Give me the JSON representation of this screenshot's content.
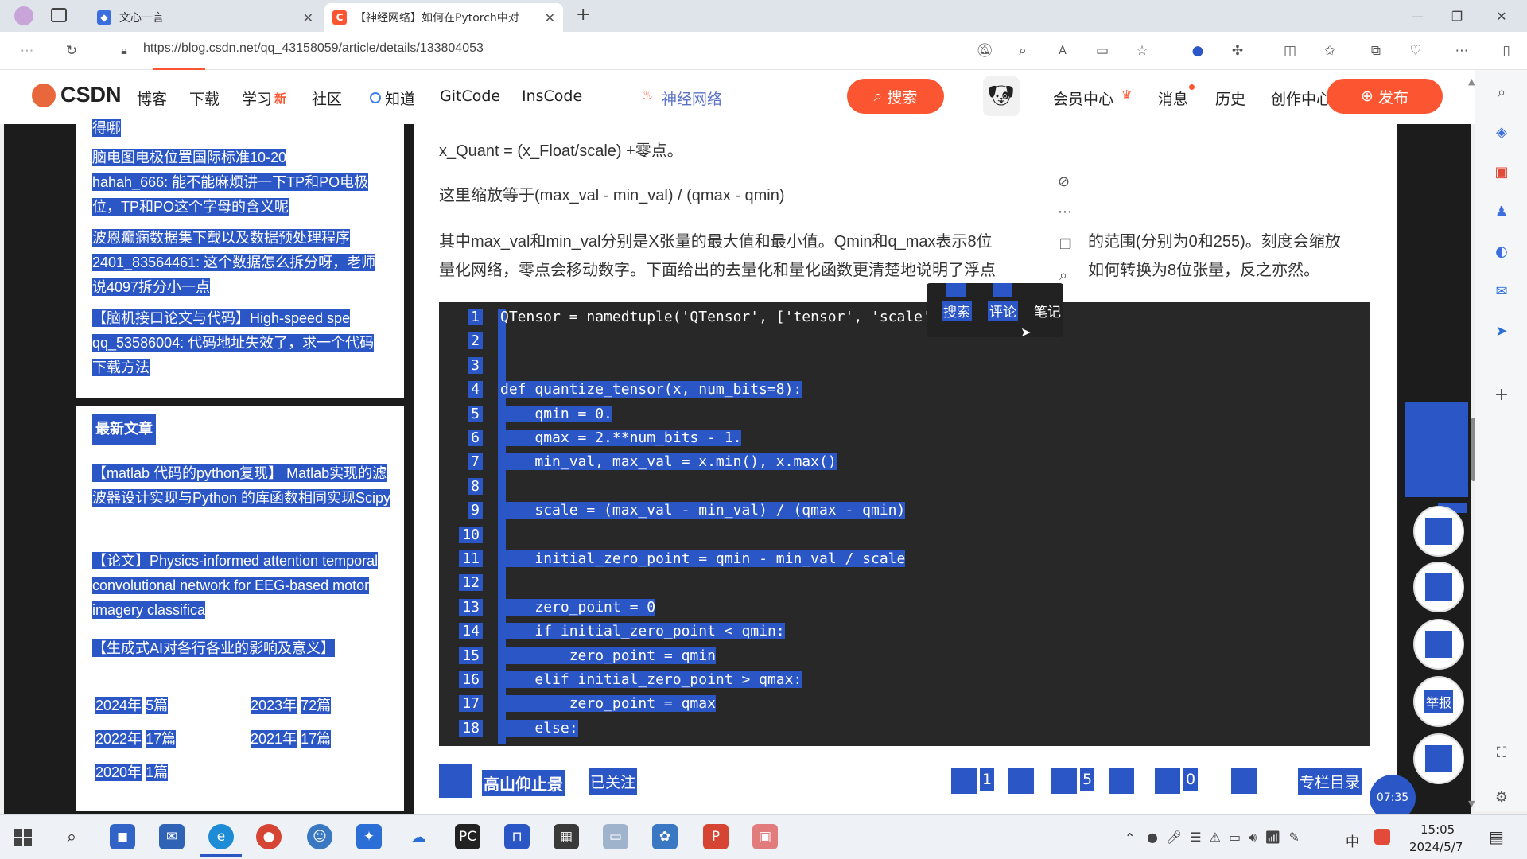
{
  "browser": {
    "tabs": [
      {
        "title": "文心一言",
        "active": false
      },
      {
        "title": "【神经网络】如何在Pytorch中对",
        "active": true
      }
    ],
    "new_tab": "+",
    "url": "https://blog.csdn.net/qq_43158059/article/details/133804053"
  },
  "csdn": {
    "logo": "CSDN",
    "nav": [
      "博客",
      "下载",
      "学习",
      "社区",
      "知道",
      "GitCode",
      "InsCode"
    ],
    "learn_badge": "新",
    "hot_search": "神经网络",
    "search_button": "搜索",
    "user_nav": [
      "会员中心",
      "消息",
      "历史",
      "创作中心"
    ],
    "publish_button": "发布"
  },
  "sidebar": {
    "cut_top": "得哪",
    "comments": [
      {
        "title": "脑电图电极位置国际标准10-20",
        "comment": "hahah_666: 能不能麻烦讲一下TP和PO电极位，TP和PO这个字母的含义呢"
      },
      {
        "title": "波恩癫痫数据集下载以及数据预处理程序",
        "comment": "2401_83564461: 这个数据怎么拆分呀，老师说4097拆分小一点"
      },
      {
        "title": "【脑机接口论文与代码】High-speed spe",
        "comment": "qq_53586004: 代码地址失效了，求一个代码下载方法"
      }
    ],
    "latest_header": "最新文章",
    "latest_articles": [
      "【matlab 代码的python复现】 Matlab实现的滤波器设计实现与Python 的库函数相同实现Scipy",
      "【论文】Physics-informed attention temporal convolutional network for EEG-based motor imagery classifica",
      "【生成式AI对各行各业的影响及意义】"
    ],
    "archive": [
      {
        "year": "2024年",
        "count": "5篇"
      },
      {
        "year": "2023年",
        "count": "72篇"
      },
      {
        "year": "2022年",
        "count": "17篇"
      },
      {
        "year": "2021年",
        "count": "17篇"
      },
      {
        "year": "2020年",
        "count": "1篇"
      }
    ]
  },
  "article": {
    "p1": "x_Quant = (x_Float/scale) +零点。",
    "p2": "这里缩放等于(max_val - min_val) / (qmax - qmin)",
    "p3a": "其中max_val和min_val分别是X张量的最大值和最小值。Qmin和q_max表示8位",
    "p3b": "的范围(分别为0和255)。刻度会缩放",
    "p4a": "量化网络，零点会移动数字。下面给出的去量化和量化函数更清楚地说明了浮点",
    "p4b": "如何转换为8位张量，反之亦然。",
    "code_lines": [
      "QTensor = namedtuple('QTensor', ['tensor', 'scale', ",
      "",
      "",
      "def quantize_tensor(x, num_bits=8):",
      "    qmin = 0.",
      "    qmax = 2.**num_bits - 1.",
      "    min_val, max_val = x.min(), x.max()",
      "",
      "    scale = (max_val - min_val) / (qmax - qmin)",
      "",
      "    initial_zero_point = qmin - min_val / scale",
      "",
      "    zero_point = 0",
      "    if initial_zero_point < qmin:",
      "        zero_point = qmin",
      "    elif initial_zero_point > qmax:",
      "        zero_point = qmax",
      "    else:"
    ],
    "line_numbers": [
      "1",
      "2",
      "3",
      "4",
      "5",
      "6",
      "7",
      "8",
      "9",
      "10",
      "11",
      "12",
      "13",
      "14",
      "15",
      "16",
      "17",
      "18"
    ]
  },
  "selection_popup": {
    "search": "搜索",
    "comment": "评论",
    "note": "笔记"
  },
  "bottom_bar": {
    "author": "高山仰止景",
    "follow": "已关注",
    "like_count": "1",
    "collect_count": "5",
    "comment_count": "0",
    "catalog": "专栏目录",
    "timer": "07:35"
  },
  "right_float": {
    "report": "举报"
  },
  "taskbar": {
    "time": "15:05",
    "date": "2024/5/7",
    "ime": "中"
  }
}
